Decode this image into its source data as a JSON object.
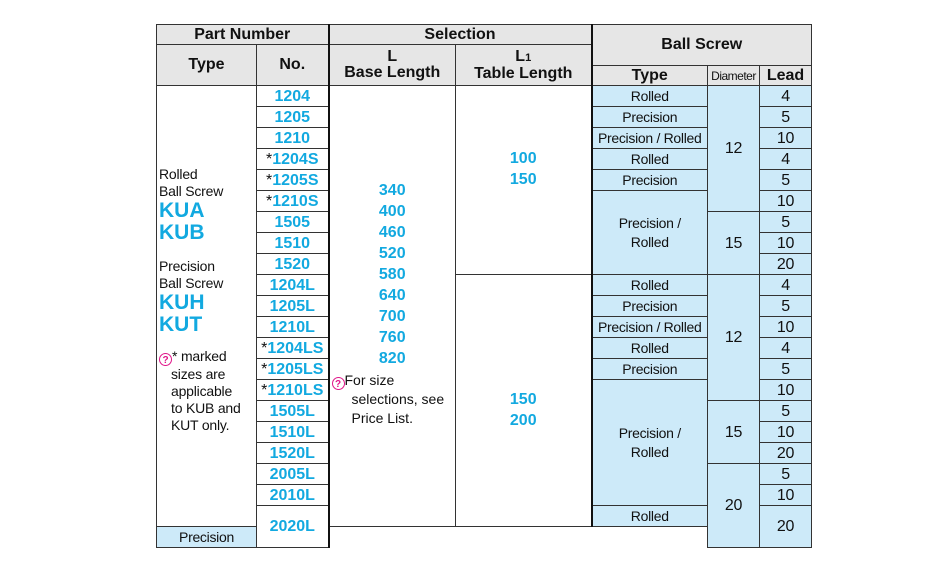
{
  "headers": {
    "part_number": "Part Number",
    "type": "Type",
    "no": "No.",
    "selection": "Selection",
    "l": "L",
    "base_length": "Base Length",
    "l1_main": "L",
    "l1_sub": "1",
    "table_length": "Table Length",
    "ball_screw": "Ball Screw",
    "bs_type": "Type",
    "diameter": "Diameter",
    "lead": "Lead"
  },
  "type_column": {
    "rolled_label_1": "Rolled",
    "rolled_label_2": "Ball Screw",
    "rolled_brand_1": "KUA",
    "rolled_brand_2": "KUB",
    "precision_label_1": "Precision",
    "precision_label_2": "Ball Screw",
    "precision_brand_1": "KUH",
    "precision_brand_2": "KUT",
    "note_icon": "caution-icon",
    "note_1": "* marked",
    "note_2": "sizes are",
    "note_3": "applicable",
    "note_4": "to KUB and",
    "note_5": "KUT only."
  },
  "numbers": [
    {
      "ast": "",
      "no": "1204"
    },
    {
      "ast": "",
      "no": "1205"
    },
    {
      "ast": "",
      "no": "1210"
    },
    {
      "ast": "*",
      "no": "1204S"
    },
    {
      "ast": "*",
      "no": "1205S"
    },
    {
      "ast": "*",
      "no": "1210S"
    },
    {
      "ast": "",
      "no": "1505"
    },
    {
      "ast": "",
      "no": "1510"
    },
    {
      "ast": "",
      "no": "1520"
    },
    {
      "ast": "",
      "no": "1204L"
    },
    {
      "ast": "",
      "no": "1205L"
    },
    {
      "ast": "",
      "no": "1210L"
    },
    {
      "ast": "*",
      "no": "1204LS"
    },
    {
      "ast": "*",
      "no": "1205LS"
    },
    {
      "ast": "*",
      "no": "1210LS"
    },
    {
      "ast": "",
      "no": "1505L"
    },
    {
      "ast": "",
      "no": "1510L"
    },
    {
      "ast": "",
      "no": "1520L"
    },
    {
      "ast": "",
      "no": "2005L"
    },
    {
      "ast": "",
      "no": "2010L"
    },
    {
      "ast": "",
      "no": "2020L"
    }
  ],
  "base_length": {
    "values": [
      "340",
      "400",
      "460",
      "520",
      "580",
      "640",
      "700",
      "760",
      "820"
    ],
    "note_1": "For size",
    "note_2": "selections, see",
    "note_3": "Price List."
  },
  "table_length": {
    "group1": [
      "100",
      "150"
    ],
    "group2": [
      "150",
      "200"
    ]
  },
  "ball_screw": {
    "types": [
      "Rolled",
      "Precision",
      "Precision / Rolled",
      "Rolled",
      "Precision",
      "Precision /",
      "Rolled",
      "Rolled",
      "Precision",
      "Precision / Rolled",
      "Rolled",
      "Precision",
      "Precision /",
      "Rolled",
      "Rolled",
      "Precision"
    ],
    "diameters": [
      "12",
      "15",
      "12",
      "15",
      "20"
    ],
    "leads": [
      "4",
      "5",
      "10",
      "4",
      "5",
      "10",
      "5",
      "10",
      "20",
      "4",
      "5",
      "10",
      "4",
      "5",
      "10",
      "5",
      "10",
      "20",
      "5",
      "10",
      "20"
    ]
  },
  "colors": {
    "accent": "#12a9e0",
    "cell_bg": "#cdeaf9",
    "header_bg": "#e6e6e6",
    "note_icon": "#e0168a"
  }
}
